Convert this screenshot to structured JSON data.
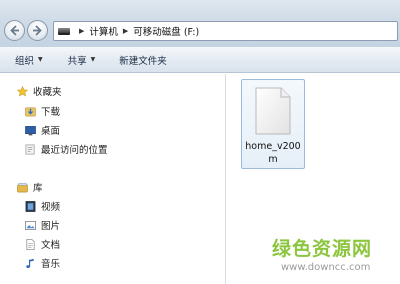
{
  "address_bar": {
    "drive_icon": "removable-drive-icon",
    "breadcrumbs": [
      "计算机",
      "可移动磁盘 (F:)"
    ]
  },
  "toolbar": {
    "organize_label": "组织",
    "share_label": "共享",
    "new_folder_label": "新建文件夹"
  },
  "sidebar": {
    "favorites": {
      "label": "收藏夹",
      "items": [
        {
          "label": "下载",
          "icon": "download-folder-icon"
        },
        {
          "label": "桌面",
          "icon": "desktop-icon"
        },
        {
          "label": "最近访问的位置",
          "icon": "recent-places-icon"
        }
      ]
    },
    "libraries": {
      "label": "库",
      "items": [
        {
          "label": "视频",
          "icon": "video-library-icon"
        },
        {
          "label": "图片",
          "icon": "pictures-library-icon"
        },
        {
          "label": "文档",
          "icon": "documents-library-icon"
        },
        {
          "label": "音乐",
          "icon": "music-library-icon"
        }
      ]
    }
  },
  "files": [
    {
      "name": "home_v200m",
      "icon": "generic-file-icon"
    }
  ],
  "watermark": {
    "title": "绿色资源网",
    "url": "www.downcc.com"
  },
  "colors": {
    "watermark_green": "#8cc63f",
    "selection_border": "#9bbbd9"
  }
}
